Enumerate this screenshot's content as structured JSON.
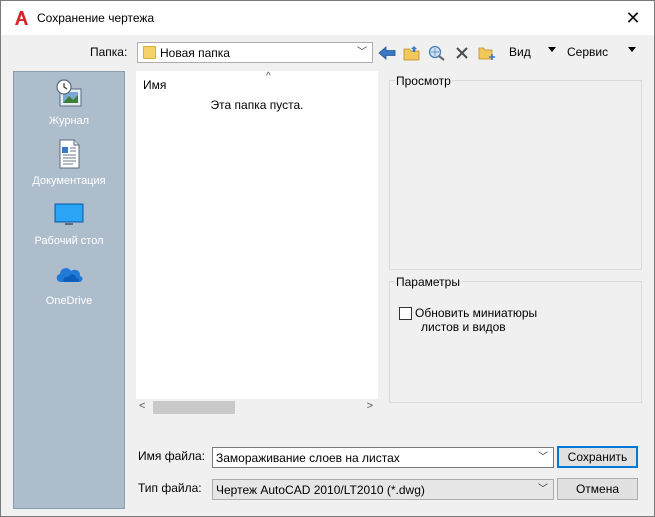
{
  "window": {
    "title": "Сохранение чертежа",
    "close": "✕"
  },
  "toolbar": {
    "folder_label": "Папка:",
    "folder_value": "Новая папка",
    "view_label": "Вид",
    "tools_label": "Сервис"
  },
  "places": [
    {
      "label": "Журнал",
      "icon": "history-icon"
    },
    {
      "label": "Документация",
      "icon": "documents-icon"
    },
    {
      "label": "Рабочий стол",
      "icon": "desktop-icon"
    },
    {
      "label": "OneDrive",
      "icon": "onedrive-icon"
    }
  ],
  "filelist": {
    "column_name": "Имя",
    "empty_message": "Эта папка пуста."
  },
  "preview": {
    "title": "Просмотр"
  },
  "options": {
    "title": "Параметры",
    "update_thumbnails_line1": "Обновить миниатюры",
    "update_thumbnails_line2": "листов и видов",
    "update_thumbnails_checked": false
  },
  "footer": {
    "filename_label": "Имя файла:",
    "filename_value": "Замораживание слоев на листах",
    "filetype_label": "Тип файла:",
    "filetype_value": "Чертеж AutoCAD 2010/LT2010 (*.dwg)",
    "save_button": "Сохранить",
    "cancel_button": "Отмена"
  },
  "colors": {
    "places_bg": "#aebdcc",
    "accent": "#0078d7",
    "logo_red": "#d4262c"
  }
}
